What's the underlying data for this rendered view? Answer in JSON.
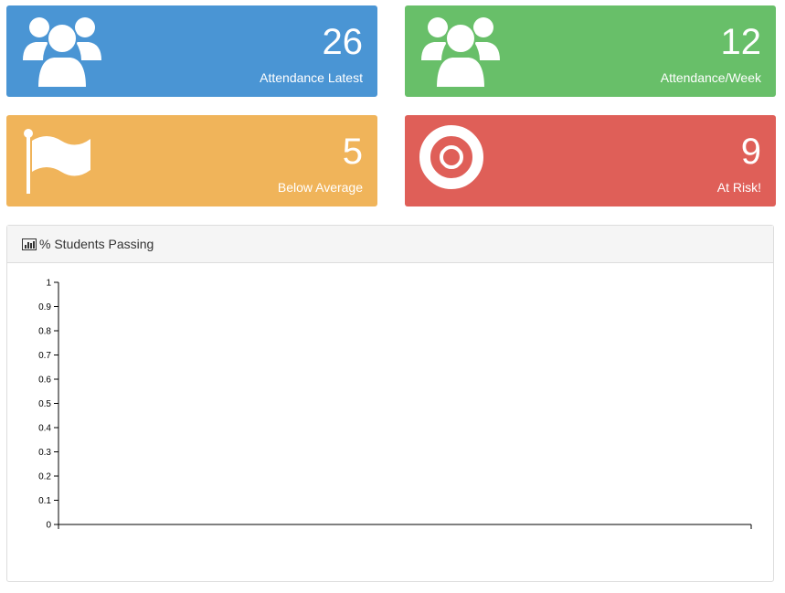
{
  "cards": [
    {
      "value": "26",
      "label": "Attendance Latest",
      "icon": "users-icon",
      "color": "#4a95d4"
    },
    {
      "value": "12",
      "label": "Attendance/Week",
      "icon": "users-icon",
      "color": "#68bf69"
    },
    {
      "value": "5",
      "label": "Below Average",
      "icon": "flag-icon",
      "color": "#f0b45a"
    },
    {
      "value": "9",
      "label": "At Risk!",
      "icon": "life-ring-icon",
      "color": "#df5f58"
    }
  ],
  "panel": {
    "title": "% Students Passing",
    "icon": "bar-chart-icon"
  },
  "chart_data": {
    "type": "line",
    "title": "",
    "xlabel": "",
    "ylabel": "",
    "ylim": [
      0,
      1
    ],
    "y_ticks": [
      "0",
      "0.1",
      "0.2",
      "0.3",
      "0.4",
      "0.5",
      "0.6",
      "0.7",
      "0.8",
      "0.9",
      "1"
    ],
    "series": []
  }
}
